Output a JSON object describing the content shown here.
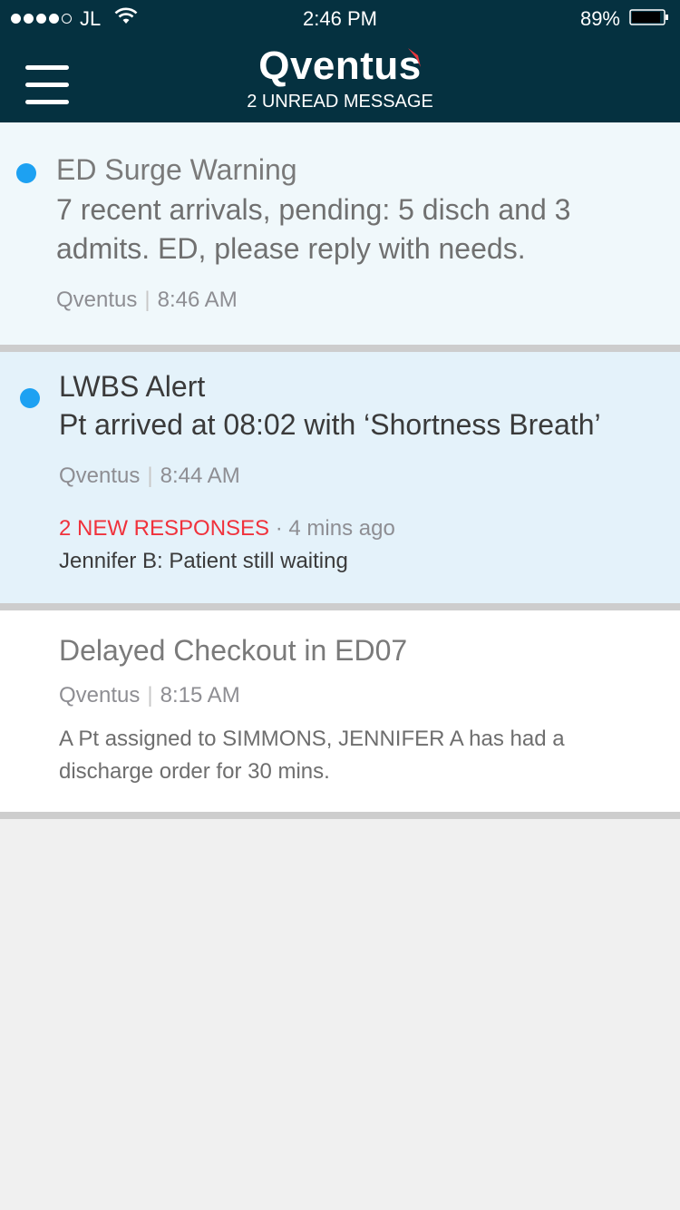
{
  "status_bar": {
    "carrier": "JL",
    "time": "2:46 PM",
    "battery": "89%"
  },
  "header": {
    "logo": "Qventus",
    "subtitle": "2 UNREAD MESSAGE"
  },
  "messages": [
    {
      "title": "ED Surge Warning",
      "body": "7 recent arrivals, pending: 5 disch and 3 admits. ED, please reply with needs.",
      "sender": "Qventus",
      "separator": "|",
      "time": "8:46 AM",
      "unread": true
    },
    {
      "title": "LWBS Alert",
      "body": "Pt arrived at 08:02 with ‘Shortness Breath’",
      "sender": "Qventus",
      "separator": "|",
      "time": "8:44 AM",
      "unread": true,
      "responses_label": "2 NEW RESPONSES",
      "responses_time": "· 4 mins ago",
      "latest_reply": "Jennifer B: Patient still waiting"
    },
    {
      "title": "Delayed Checkout in ED07",
      "sender": "Qventus",
      "separator": "|",
      "time": "8:15 AM",
      "body": "A Pt assigned to SIMMONS, JENNIFER A has had a discharge order for 30 mins.",
      "unread": false
    }
  ],
  "colors": {
    "header_bg": "#053140",
    "unread_dot": "#1da1f2",
    "responses_red": "#f0323c",
    "card1_bg": "#f0f8fb",
    "card2_bg": "#e4f2fa",
    "card3_bg": "#ffffff"
  }
}
